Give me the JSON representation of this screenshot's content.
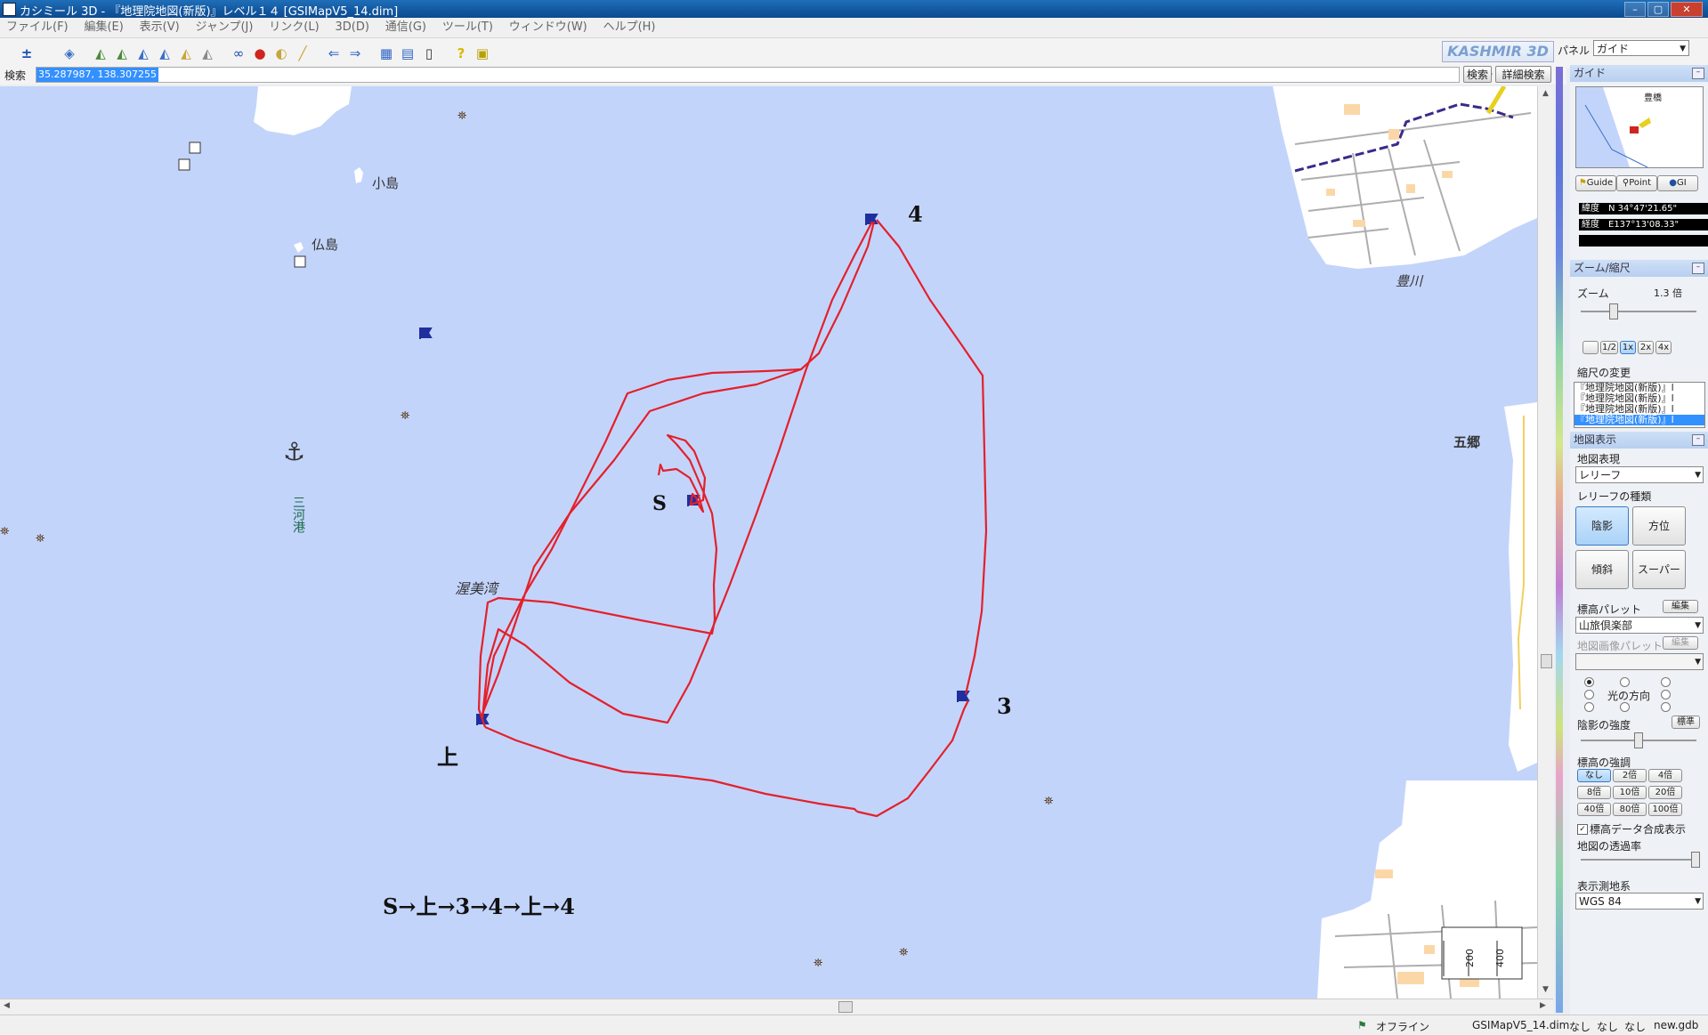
{
  "window": {
    "title": "カシミール 3D - 『地理院地図(新版)』レベル１４ [GSIMapV5_14.dim]",
    "minimize": "–",
    "restore": "▢",
    "close": "✕"
  },
  "menu": [
    "ファイル(F)",
    "編集(E)",
    "表示(V)",
    "ジャンプ(J)",
    "リンク(L)",
    "3D(D)",
    "通信(G)",
    "ツール(T)",
    "ウィンドウ(W)",
    "ヘルプ(H)"
  ],
  "toolbar": {
    "brand": "KASHMIR 3D",
    "panel_label": "パネル",
    "panel_value": "ガイド",
    "icons": [
      "zoom-search-icon",
      "layer-icon",
      "map-layer-1-icon",
      "map-layer-2-icon",
      "map-layer-3-icon",
      "map-layer-4-icon",
      "map-layer-5-icon",
      "map-layer-6-icon",
      "binoculars-icon",
      "markers-icon",
      "track-icon",
      "ruler-icon",
      "back-arrow-icon",
      "forward-arrow-icon",
      "grid-icon",
      "calculator-icon",
      "gps-device-icon",
      "help-icon",
      "exit-icon"
    ]
  },
  "search": {
    "label": "検索",
    "value": "35.287987, 138.307255",
    "search_button": "検索",
    "detail_button": "詳細検索"
  },
  "map": {
    "labels": {
      "kojima": "小島",
      "hotokejima": "仏島",
      "mikawa_port": "三河港",
      "atsumi_bay": "渥美湾",
      "toyokawa": "豊川",
      "gogo": "五郷",
      "start": "S",
      "kami": "上",
      "mark3": "3",
      "mark4": "4",
      "route": "S→上→3→4→上→4"
    },
    "scale_ticks": [
      "200",
      "400"
    ],
    "track_color": "#e4202a",
    "water_color": "#c3d4fb"
  },
  "sidebar": {
    "guide": {
      "header": "ガイド",
      "inset_label": "豊橋",
      "tabs": [
        "Guide",
        "Point",
        "GI"
      ],
      "lat": "緯度　N 34°47'21.65\"",
      "lon": "経度　E137°13'08.33\"",
      "third": ""
    },
    "zoom": {
      "header": "ズーム/縮尺",
      "label": "ズーム",
      "value": "1.3 倍",
      "buttons": [
        "1/2",
        "1x",
        "2x",
        "4x"
      ],
      "scale_label": "縮尺の変更",
      "list": [
        "『地理院地図(新版)』l",
        "『地理院地図(新版)』l",
        "『地理院地図(新版)』l",
        "『地理院地図(新版)』l",
        "『地理院地図(新版)』l",
        "『地理院地図(新版)』l"
      ]
    },
    "display": {
      "header": "地図表示",
      "expression_label": "地図表現",
      "expression_value": "レリーフ",
      "relief_type_label": "レリーフの種類",
      "relief_buttons": [
        "陰影",
        "方位",
        "傾斜",
        "スーパー"
      ],
      "elev_palette_label": "標高パレット",
      "edit": "編集",
      "elev_palette_value": "山旅倶楽部",
      "img_palette_label": "地図画像パレット",
      "img_edit": "編集",
      "light_dir_label": "光の方向",
      "shade_label": "陰影の強度",
      "shade_std": "標準",
      "emphasis_label": "標高の強調",
      "emphasis_buttons": [
        "なし",
        "2倍",
        "4倍",
        "8倍",
        "10倍",
        "20倍",
        "40倍",
        "80倍",
        "100倍"
      ],
      "composite_label": "標高データ合成表示",
      "composite_checked": true,
      "opacity_label": "地図の透過率",
      "datum_label": "表示測地系",
      "datum_value": "WGS 84"
    }
  },
  "status": {
    "offline": "オフライン",
    "file": "GSIMapV5_14.dim",
    "n1": "なし",
    "n2": "なし",
    "n3": "なし",
    "gdb": "new.gdb"
  }
}
